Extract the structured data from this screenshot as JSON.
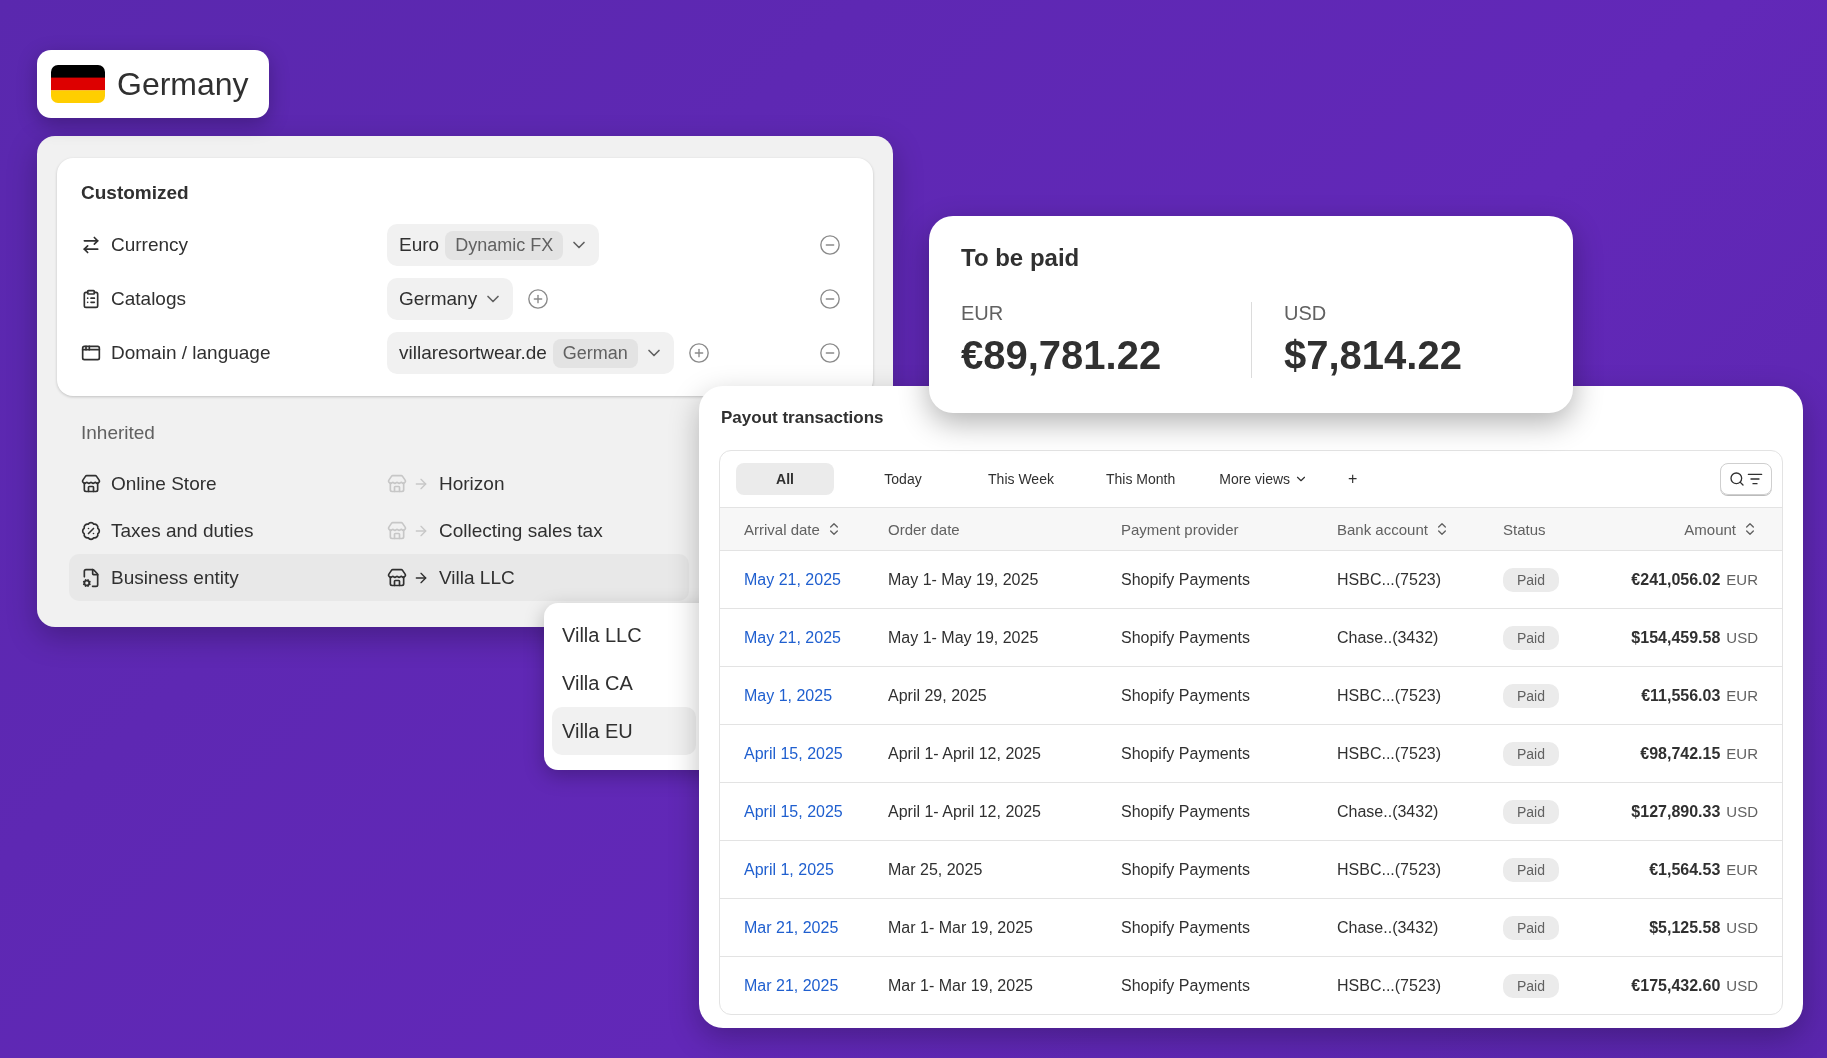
{
  "country_badge": {
    "name": "Germany"
  },
  "settings": {
    "customized": {
      "title": "Customized",
      "rows": [
        {
          "label": "Currency",
          "value": "Euro",
          "tag": "Dynamic FX",
          "can_add": false
        },
        {
          "label": "Catalogs",
          "value": "Germany",
          "can_add": true
        },
        {
          "label": "Domain / language",
          "value": "villaresortwear.de",
          "tag": "German",
          "can_add": true
        }
      ]
    },
    "inherited": {
      "title": "Inherited",
      "rows": [
        {
          "label": "Online Store",
          "target": "Horizon",
          "selected": false
        },
        {
          "label": "Taxes and duties",
          "target": "Collecting sales tax",
          "selected": false
        },
        {
          "label": "Business entity",
          "target": "Villa LLC",
          "selected": true
        }
      ]
    }
  },
  "entity_menu": {
    "items": [
      {
        "label": "Villa LLC",
        "selected": false
      },
      {
        "label": "Villa CA",
        "selected": false
      },
      {
        "label": "Villa EU",
        "selected": true
      }
    ]
  },
  "to_be_paid": {
    "title": "To be paid",
    "totals": [
      {
        "currency": "EUR",
        "amount": "€89,781.22"
      },
      {
        "currency": "USD",
        "amount": "$7,814.22"
      }
    ]
  },
  "payouts": {
    "title": "Payout transactions",
    "views": [
      {
        "label": "All",
        "selected": true
      },
      {
        "label": "Today",
        "selected": false
      },
      {
        "label": "This Week",
        "selected": false
      },
      {
        "label": "This Month",
        "selected": false
      }
    ],
    "more_views": "More views",
    "add": "+",
    "columns": [
      {
        "label": "Arrival date",
        "sortable": true
      },
      {
        "label": "Order date",
        "sortable": false
      },
      {
        "label": "Payment provider",
        "sortable": false
      },
      {
        "label": "Bank account",
        "sortable": true
      },
      {
        "label": "Status",
        "sortable": false
      },
      {
        "label": "Amount",
        "sortable": true
      }
    ],
    "rows": [
      {
        "arrival": "May 21, 2025",
        "order": "May 1- May 19, 2025",
        "provider": "Shopify Payments",
        "bank": "HSBC...(7523)",
        "status": "Paid",
        "amount": "€241,056.02",
        "currency": "EUR"
      },
      {
        "arrival": "May 21, 2025",
        "order": "May 1- May 19, 2025",
        "provider": "Shopify Payments",
        "bank": "Chase..(3432)",
        "status": "Paid",
        "amount": "$154,459.58",
        "currency": "USD"
      },
      {
        "arrival": "May 1, 2025",
        "order": "April 29, 2025",
        "provider": "Shopify Payments",
        "bank": "HSBC...(7523)",
        "status": "Paid",
        "amount": "€11,556.03",
        "currency": "EUR"
      },
      {
        "arrival": "April 15, 2025",
        "order": "April 1- April 12, 2025",
        "provider": "Shopify Payments",
        "bank": "HSBC...(7523)",
        "status": "Paid",
        "amount": "€98,742.15",
        "currency": "EUR"
      },
      {
        "arrival": "April 15, 2025",
        "order": "April 1- April 12, 2025",
        "provider": "Shopify Payments",
        "bank": "Chase..(3432)",
        "status": "Paid",
        "amount": "$127,890.33",
        "currency": "USD"
      },
      {
        "arrival": "April 1, 2025",
        "order": "Mar 25, 2025",
        "provider": "Shopify Payments",
        "bank": "HSBC...(7523)",
        "status": "Paid",
        "amount": "€1,564.53",
        "currency": "EUR"
      },
      {
        "arrival": "Mar 21, 2025",
        "order": "Mar 1- Mar 19, 2025",
        "provider": "Shopify Payments",
        "bank": "Chase..(3432)",
        "status": "Paid",
        "amount": "$5,125.58",
        "currency": "USD"
      },
      {
        "arrival": "Mar 21, 2025",
        "order": "Mar 1- Mar 19, 2025",
        "provider": "Shopify Payments",
        "bank": "HSBC...(7523)",
        "status": "Paid",
        "amount": "€175,432.60",
        "currency": "USD"
      }
    ]
  }
}
